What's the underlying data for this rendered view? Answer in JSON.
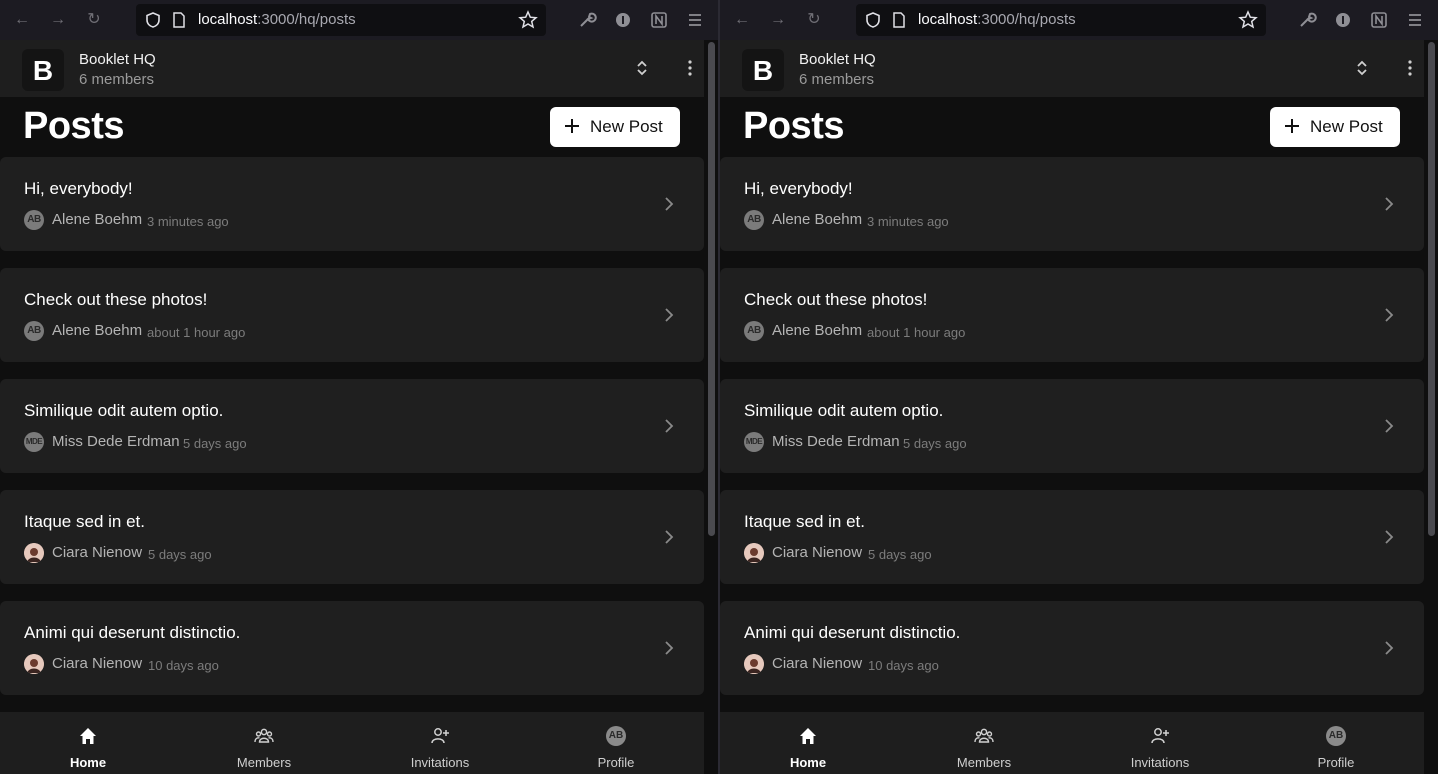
{
  "browser": {
    "url_host": "localhost",
    "url_path": ":3000/hq/posts"
  },
  "org": {
    "logo_letter": "B",
    "name": "Booklet HQ",
    "members": "6 members"
  },
  "page": {
    "title": "Posts",
    "new_post_label": "New Post"
  },
  "posts": [
    {
      "title": "Hi, everybody!",
      "author": "Alene Boehm",
      "initials": "AB",
      "time": "3 minutes ago"
    },
    {
      "title": "Check out these photos!",
      "author": "Alene Boehm",
      "initials": "AB",
      "time": "about 1 hour ago"
    },
    {
      "title": "Similique odit autem optio.",
      "author": "Miss Dede Erdman",
      "initials": "MDE",
      "time": "5 days ago"
    },
    {
      "title": "Itaque sed in et.",
      "author": "Ciara Nienow",
      "initials": "",
      "time": "5 days ago"
    },
    {
      "title": "Animi qui deserunt distinctio.",
      "author": "Ciara Nienow",
      "initials": "",
      "time": "10 days ago"
    }
  ],
  "nav": {
    "home": "Home",
    "members": "Members",
    "invitations": "Invitations",
    "profile": "Profile",
    "profile_initials": "AB"
  },
  "icons": {
    "back": "back-arrow-icon",
    "forward": "forward-arrow-icon",
    "reload": "reload-icon",
    "home": "home-icon",
    "members": "people-icon",
    "invitations": "user-plus-icon"
  }
}
